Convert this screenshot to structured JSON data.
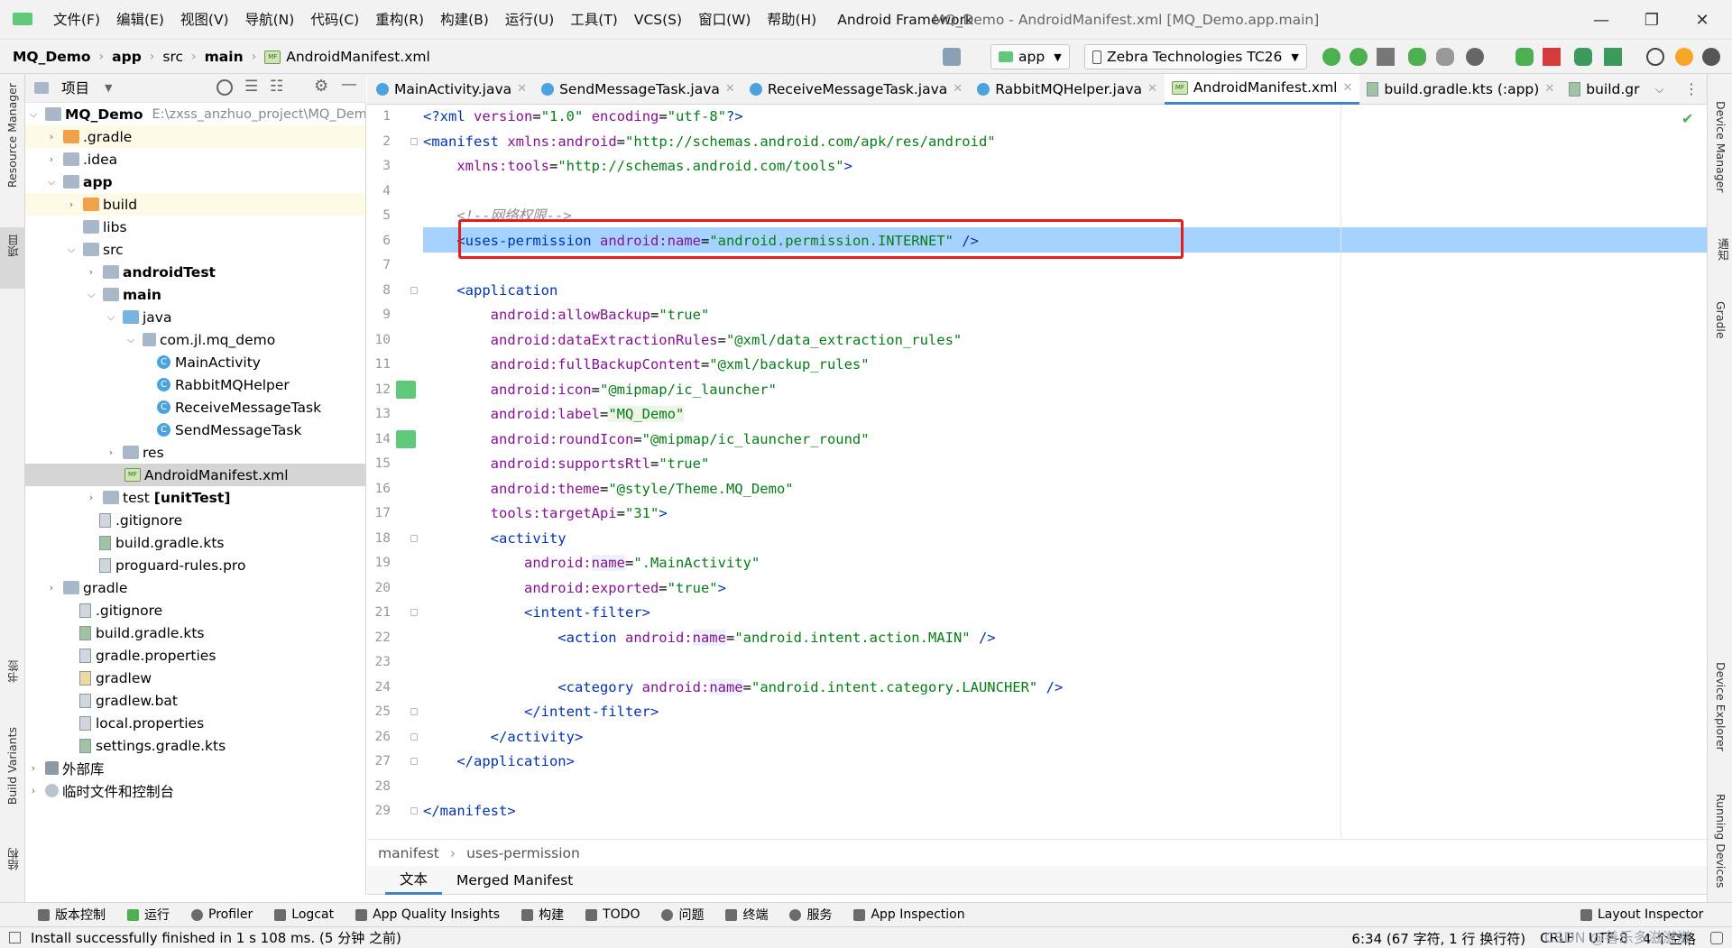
{
  "menubar": {
    "items": [
      "文件(F)",
      "编辑(E)",
      "视图(V)",
      "导航(N)",
      "代码(C)",
      "重构(R)",
      "构建(B)",
      "运行(U)",
      "工具(T)",
      "VCS(S)",
      "窗口(W)",
      "帮助(H)"
    ],
    "framework": "Android Framework",
    "window_title": "MQ_Demo - AndroidManifest.xml [MQ_Demo.app.main]"
  },
  "navbar": {
    "breadcrumb": [
      "MQ_Demo",
      "app",
      "src",
      "main",
      "AndroidManifest.xml"
    ],
    "run_config": "app",
    "device": "Zebra Technologies TC26"
  },
  "left_strip": {
    "resource_manager": "Resource Manager",
    "project": "项目",
    "bookmarks": "书签",
    "build_variants": "Build Variants",
    "structure": "结构"
  },
  "right_strip": {
    "device_manager": "Device Manager",
    "notifications": "通知",
    "gradle": "Gradle",
    "device_explorer": "Device Explorer",
    "running_devices": "Running Devices"
  },
  "project_panel": {
    "title": "项目",
    "tree": [
      {
        "label": "MQ_Demo",
        "path": "E:\\zxss_anzhuo_project\\MQ_Dem",
        "bold": true
      },
      {
        "label": ".gradle"
      },
      {
        "label": ".idea"
      },
      {
        "label": "app",
        "bold": true
      },
      {
        "label": "build"
      },
      {
        "label": "libs"
      },
      {
        "label": "src"
      },
      {
        "label": "androidTest",
        "bold": true
      },
      {
        "label": "main",
        "bold": true
      },
      {
        "label": "java"
      },
      {
        "label": "com.jl.mq_demo"
      },
      {
        "label": "MainActivity"
      },
      {
        "label": "RabbitMQHelper"
      },
      {
        "label": "ReceiveMessageTask"
      },
      {
        "label": "SendMessageTask"
      },
      {
        "label": "res"
      },
      {
        "label": "AndroidManifest.xml"
      },
      {
        "label": "test",
        "suffix": "[unitTest]"
      },
      {
        "label": ".gitignore"
      },
      {
        "label": "build.gradle.kts"
      },
      {
        "label": "proguard-rules.pro"
      },
      {
        "label": "gradle"
      },
      {
        "label": ".gitignore"
      },
      {
        "label": "build.gradle.kts"
      },
      {
        "label": "gradle.properties"
      },
      {
        "label": "gradlew"
      },
      {
        "label": "gradlew.bat"
      },
      {
        "label": "local.properties"
      },
      {
        "label": "settings.gradle.kts"
      },
      {
        "label": "外部库"
      },
      {
        "label": "临时文件和控制台"
      }
    ]
  },
  "editor": {
    "tabs": [
      "MainActivity.java",
      "SendMessageTask.java",
      "ReceiveMessageTask.java",
      "RabbitMQHelper.java",
      "AndroidManifest.xml",
      "build.gradle.kts (:app)",
      "build.gr"
    ],
    "active_tab": "AndroidManifest.xml",
    "line_numbers": [
      "1",
      "2",
      "3",
      "4",
      "5",
      "6",
      "7",
      "8",
      "9",
      "10",
      "11",
      "12",
      "13",
      "14",
      "15",
      "16",
      "17",
      "18",
      "19",
      "20",
      "21",
      "22",
      "23",
      "24",
      "25",
      "26",
      "27",
      "28",
      "29"
    ],
    "highlighted_line": 6,
    "crumb": [
      "manifest",
      "uses-permission"
    ],
    "sub_tabs": [
      "文本",
      "Merged Manifest"
    ]
  },
  "tool_bar": {
    "items": [
      "版本控制",
      "运行",
      "Profiler",
      "Logcat",
      "App Quality Insights",
      "构建",
      "TODO",
      "问题",
      "终端",
      "服务",
      "App Inspection"
    ],
    "layout_inspector": "Layout Inspector"
  },
  "status_bar": {
    "message": "Install successfully finished in 1 s 108 ms. (5 分钟 之前)",
    "position": "6:34 (67 字符, 1 行 换行符)",
    "line_sep": "CRLF",
    "encoding": "UTF-8",
    "indent": "4 个空格",
    "watermark": "CSDN @善乐多滋滋滋"
  },
  "colors": {
    "highlight": "#a6d2ff",
    "annotation_box": "#e51d1d",
    "tag": "#0033b3",
    "attr": "#871094",
    "value": "#067d17"
  }
}
